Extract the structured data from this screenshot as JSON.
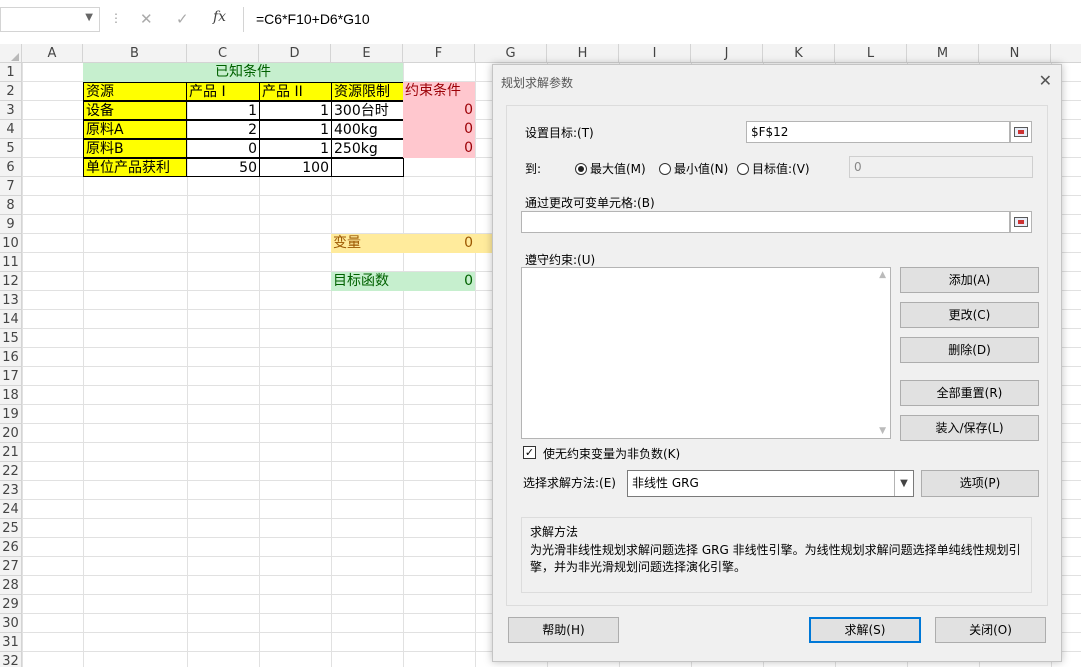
{
  "formula_bar": {
    "name_box": "",
    "fx_label": "fx",
    "cancel_glyph": "✕",
    "enter_glyph": "✓",
    "formula": "=C6*F10+D6*G10"
  },
  "columns": [
    "A",
    "B",
    "C",
    "D",
    "E",
    "F",
    "G",
    "H",
    "I",
    "J",
    "K",
    "L",
    "M",
    "N"
  ],
  "rows": [
    "1",
    "2",
    "3",
    "4",
    "5",
    "6",
    "7",
    "8",
    "9",
    "10",
    "11",
    "12",
    "13",
    "14",
    "15",
    "16",
    "17",
    "18",
    "19",
    "20",
    "21",
    "22",
    "23",
    "24",
    "25",
    "26",
    "27",
    "28",
    "29",
    "30",
    "31",
    "32"
  ],
  "sheet": {
    "title": "已知条件",
    "headers": {
      "resource": "资源",
      "product1": "产品 I",
      "product2": "产品 II",
      "limit": "资源限制",
      "constraint": "约束条件"
    },
    "table_rows": [
      {
        "name": "设备",
        "p1": "1",
        "p2": "1",
        "limit": "300台时",
        "c": "0"
      },
      {
        "name": "原料A",
        "p1": "2",
        "p2": "1",
        "limit": "400kg",
        "c": "0"
      },
      {
        "name": "原料B",
        "p1": "0",
        "p2": "1",
        "limit": "250kg",
        "c": "0"
      }
    ],
    "profit": {
      "name": "单位产品获利",
      "p1": "50",
      "p2": "100"
    },
    "variable_label": "变量",
    "variable_value": "0",
    "objective_label": "目标函数",
    "objective_value": "0"
  },
  "colors": {
    "title_fill": "#c6efce",
    "header_fill": "#ffff00",
    "constraint_fill": "#ffc7ce",
    "constraint_text": "#9c0006",
    "variable_fill": "#ffeb9c",
    "variable_text": "#9c5700",
    "objective_fill": "#c6efce",
    "objective_text": "#006100"
  },
  "dialog": {
    "title": "规划求解参数",
    "close_glyph": "✕",
    "set_objective_label": "设置目标:(T)",
    "objective_cell": "$F$12",
    "to_label": "到:",
    "radio_max": "最大值(M)",
    "radio_min": "最小值(N)",
    "radio_value": "目标值:(V)",
    "target_value": "0",
    "changing_label": "通过更改可变单元格:(B)",
    "changing_value": "",
    "constraints_label": "遵守约束:(U)",
    "buttons": {
      "add": "添加(A)",
      "change": "更改(C)",
      "delete": "删除(D)",
      "reset_all": "全部重置(R)",
      "load_save": "装入/保存(L)",
      "options": "选项(P)",
      "help": "帮助(H)",
      "solve": "求解(S)",
      "close": "关闭(O)"
    },
    "nonneg_label": "使无约束变量为非负数(K)",
    "nonneg_check": "✓",
    "method_label": "选择求解方法:(E)",
    "method_value": "非线性 GRG",
    "desc_title": "求解方法",
    "desc_text": "为光滑非线性规划求解问题选择 GRG 非线性引擎。为线性规划求解问题选择单纯线性规划引擎，并为非光滑规划问题选择演化引擎。"
  }
}
